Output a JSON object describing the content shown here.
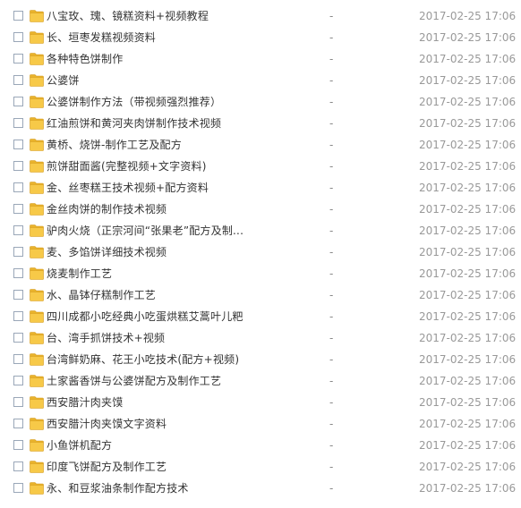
{
  "files": [
    {
      "name": "八宝玫、瑰、镜糕资料+视频教程",
      "size": "-",
      "date": "2017-02-25 17:06"
    },
    {
      "name": "长、垣枣发糕视频资料",
      "size": "-",
      "date": "2017-02-25 17:06"
    },
    {
      "name": "各种特色饼制作",
      "size": "-",
      "date": "2017-02-25 17:06"
    },
    {
      "name": "公婆饼",
      "size": "-",
      "date": "2017-02-25 17:06"
    },
    {
      "name": "公婆饼制作方法（带视频强烈推荐）",
      "size": "-",
      "date": "2017-02-25 17:06"
    },
    {
      "name": "红油煎饼和黄河夹肉饼制作技术视频",
      "size": "-",
      "date": "2017-02-25 17:06"
    },
    {
      "name": "黄桥、烧饼-制作工艺及配方",
      "size": "-",
      "date": "2017-02-25 17:06"
    },
    {
      "name": "煎饼甜面酱(完整视频+文字资料)",
      "size": "-",
      "date": "2017-02-25 17:06"
    },
    {
      "name": "金、丝枣糕王技术视频+配方资料",
      "size": "-",
      "date": "2017-02-25 17:06"
    },
    {
      "name": "金丝肉饼的制作技术视频",
      "size": "-",
      "date": "2017-02-25 17:06"
    },
    {
      "name": "驴肉火烧（正宗河间“张果老”配方及制...",
      "size": "-",
      "date": "2017-02-25 17:06"
    },
    {
      "name": "麦、多馅饼详细技术视频",
      "size": "-",
      "date": "2017-02-25 17:06"
    },
    {
      "name": "烧麦制作工艺",
      "size": "-",
      "date": "2017-02-25 17:06"
    },
    {
      "name": "水、晶钵仔糕制作工艺",
      "size": "-",
      "date": "2017-02-25 17:06"
    },
    {
      "name": "四川成都小吃经典小吃蛋烘糕艾蒿叶儿粑",
      "size": "-",
      "date": "2017-02-25 17:06"
    },
    {
      "name": "台、湾手抓饼技术+视频",
      "size": "-",
      "date": "2017-02-25 17:06"
    },
    {
      "name": "台湾鲜奶麻、花王小吃技术(配方+视频)",
      "size": "-",
      "date": "2017-02-25 17:06"
    },
    {
      "name": "土家酱香饼与公婆饼配方及制作工艺",
      "size": "-",
      "date": "2017-02-25 17:06"
    },
    {
      "name": "西安腊汁肉夹馍",
      "size": "-",
      "date": "2017-02-25 17:06"
    },
    {
      "name": "西安腊汁肉夹馍文字资料",
      "size": "-",
      "date": "2017-02-25 17:06"
    },
    {
      "name": "小鱼饼机配方",
      "size": "-",
      "date": "2017-02-25 17:06"
    },
    {
      "name": "印度飞饼配方及制作工艺",
      "size": "-",
      "date": "2017-02-25 17:06"
    },
    {
      "name": "永、和豆浆油条制作配方技术",
      "size": "-",
      "date": "2017-02-25 17:06"
    }
  ],
  "icons": {
    "row_icon": "folder-icon",
    "checkbox": "checkbox"
  },
  "colors": {
    "folder_fill": "#f7c948",
    "folder_tab": "#e9b32c",
    "folder_edge": "#d49a1a",
    "checkbox_border": "#9aa7b8"
  }
}
